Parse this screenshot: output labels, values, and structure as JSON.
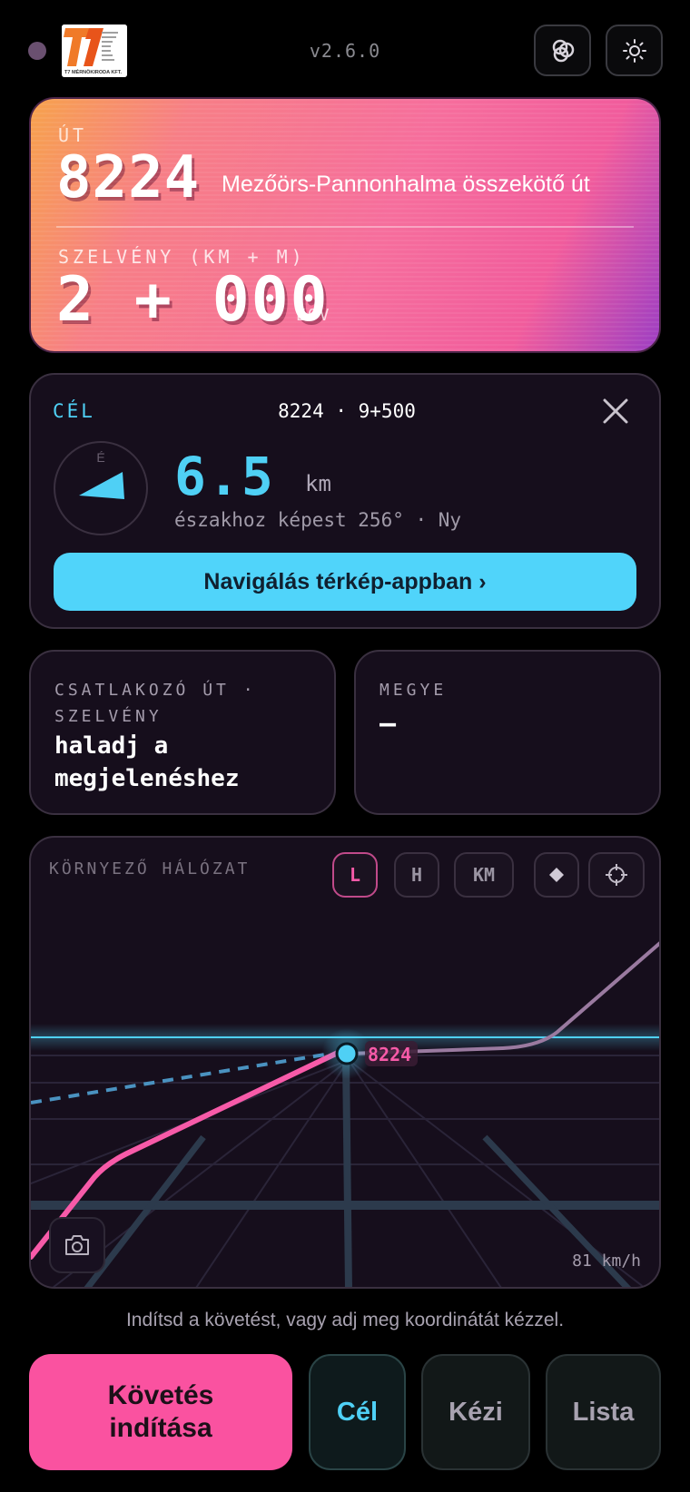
{
  "header": {
    "version": "v2.6.0",
    "logo_caption": "T7 MÉRNÖKIRODA KFT.",
    "logo_lines": [
      "Technologia",
      "Transport",
      "Traffic",
      "Trend",
      "Trade",
      "Tumble",
      "Transfer"
    ],
    "icons": {
      "status": "status-dot-icon",
      "theme_palette": "palette-icon",
      "brightness": "sun-icon"
    }
  },
  "road_card": {
    "label_road": "ÚT",
    "road_number": "8224",
    "road_name": "Mezőörs-Pannonhalma összekötő út",
    "label_section": "SZELVÉNY (KM + M)",
    "section_value": "2 + 000",
    "projection": "EOV"
  },
  "target_card": {
    "label": "CÉL",
    "target": "8224 · 9+500",
    "compass_north": "É",
    "distance": "6.5",
    "distance_unit": "km",
    "bearing_text": "északhoz képest 256° · Ny",
    "nav_button": "Navigálás térkép-appban ›",
    "bearing_deg": 256,
    "accent_color": "#4fd0f5"
  },
  "info_cards": {
    "junction": {
      "label": "CSATLAKOZÓ ÚT · SZELVÉNY",
      "value": "haladj a megjelenéshez"
    },
    "county": {
      "label": "MEGYE",
      "value": "–"
    }
  },
  "network_map": {
    "label": "KÖRNYEZŐ HÁLÓZAT",
    "buttons": {
      "l": "L",
      "h": "H",
      "km": "KM"
    },
    "current_road_label": "8224",
    "speed": "81 km/h",
    "colors": {
      "current_road": "#f75aa8",
      "horizon": "#4fd0f5",
      "other_road": "#9a7aa0"
    }
  },
  "hint": "Indítsd a követést, vagy adj meg koordinátát kézzel.",
  "bottom_bar": {
    "start_tracking": "Követés indítása",
    "target": "Cél",
    "manual": "Kézi",
    "list": "Lista"
  }
}
